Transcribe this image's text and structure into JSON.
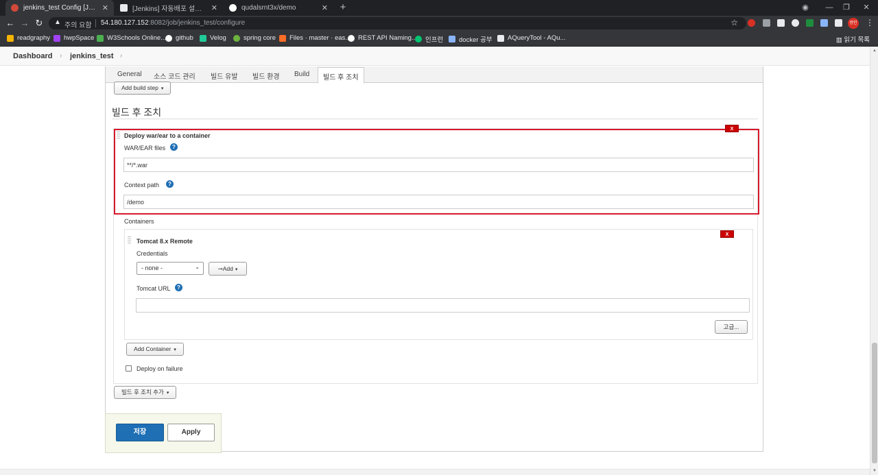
{
  "browser": {
    "tabs": [
      {
        "title": "jenkins_test Config [Jenkins]",
        "active": true,
        "favicon_color": "#d24939"
      },
      {
        "title": "[Jenkins] 자동배포 설정 :: 개인의",
        "active": false,
        "favicon_color": "#e8eaed"
      },
      {
        "title": "qudalsrnt3x/demo",
        "active": false,
        "favicon_color": "#ffffff"
      }
    ],
    "new_tab_icon": "+",
    "security_label": "주의 요함",
    "url_host": "54.180.127.152",
    "url_path": ":8082/job/jenkins_test/configure",
    "profile_label": "방인",
    "bookmarks": [
      {
        "label": "readgraphy",
        "color": "#f4b400"
      },
      {
        "label": "hwpSpace",
        "color": "#a142f4"
      },
      {
        "label": "W3Schools Online...",
        "color": "#4caf50"
      },
      {
        "label": "github",
        "color": "#ffffff"
      },
      {
        "label": "Velog",
        "color": "#20c997"
      },
      {
        "label": "spring core",
        "color": "#6db33f"
      },
      {
        "label": "Files · master · eas...",
        "color": "#fc6d26"
      },
      {
        "label": "REST API Naming...",
        "color": "#ffffff"
      },
      {
        "label": "인프런",
        "color": "#00c471"
      },
      {
        "label": "docker 공부",
        "color": "#8ab4f8"
      },
      {
        "label": "AQueryTool - AQu...",
        "color": "#e8eaed"
      }
    ],
    "reading_list": "읽기 목록"
  },
  "breadcrumbs": {
    "items": [
      "Dashboard",
      "jenkins_test"
    ],
    "separator": "›"
  },
  "config": {
    "tabs": [
      "General",
      "소스 코드 관리",
      "빌드 유발",
      "빌드 환경",
      "Build",
      "빌드 후 조치"
    ],
    "active_tab": "빌드 후 조치",
    "add_build_step": "Add build step",
    "section_title": "빌드 후 조치",
    "deploy": {
      "title": "Deploy war/ear to a container",
      "war_label": "WAR/EAR files",
      "war_value": "**/*.war",
      "context_label": "Context path",
      "context_value": "/demo",
      "containers_label": "Containers",
      "delete_label": "X"
    },
    "tomcat": {
      "title": "Tomcat 8.x Remote",
      "credentials_label": "Credentials",
      "credentials_value": "- none -",
      "add_label": "Add",
      "url_label": "Tomcat URL",
      "url_value": "",
      "advanced_label": "고급...",
      "delete_label": "X"
    },
    "add_container": "Add Container",
    "deploy_on_failure": "Deploy on failure",
    "deploy_on_failure_checked": false,
    "add_post_build": "빌드 후 조치 추가",
    "save_label": "저장",
    "apply_label": "Apply",
    "help_glyph": "?",
    "caret_glyph": "▾"
  },
  "colors": {
    "jenkins_blue": "#1f6fb5",
    "highlight_red": "#d6182b",
    "delete_red": "#cc0000"
  }
}
